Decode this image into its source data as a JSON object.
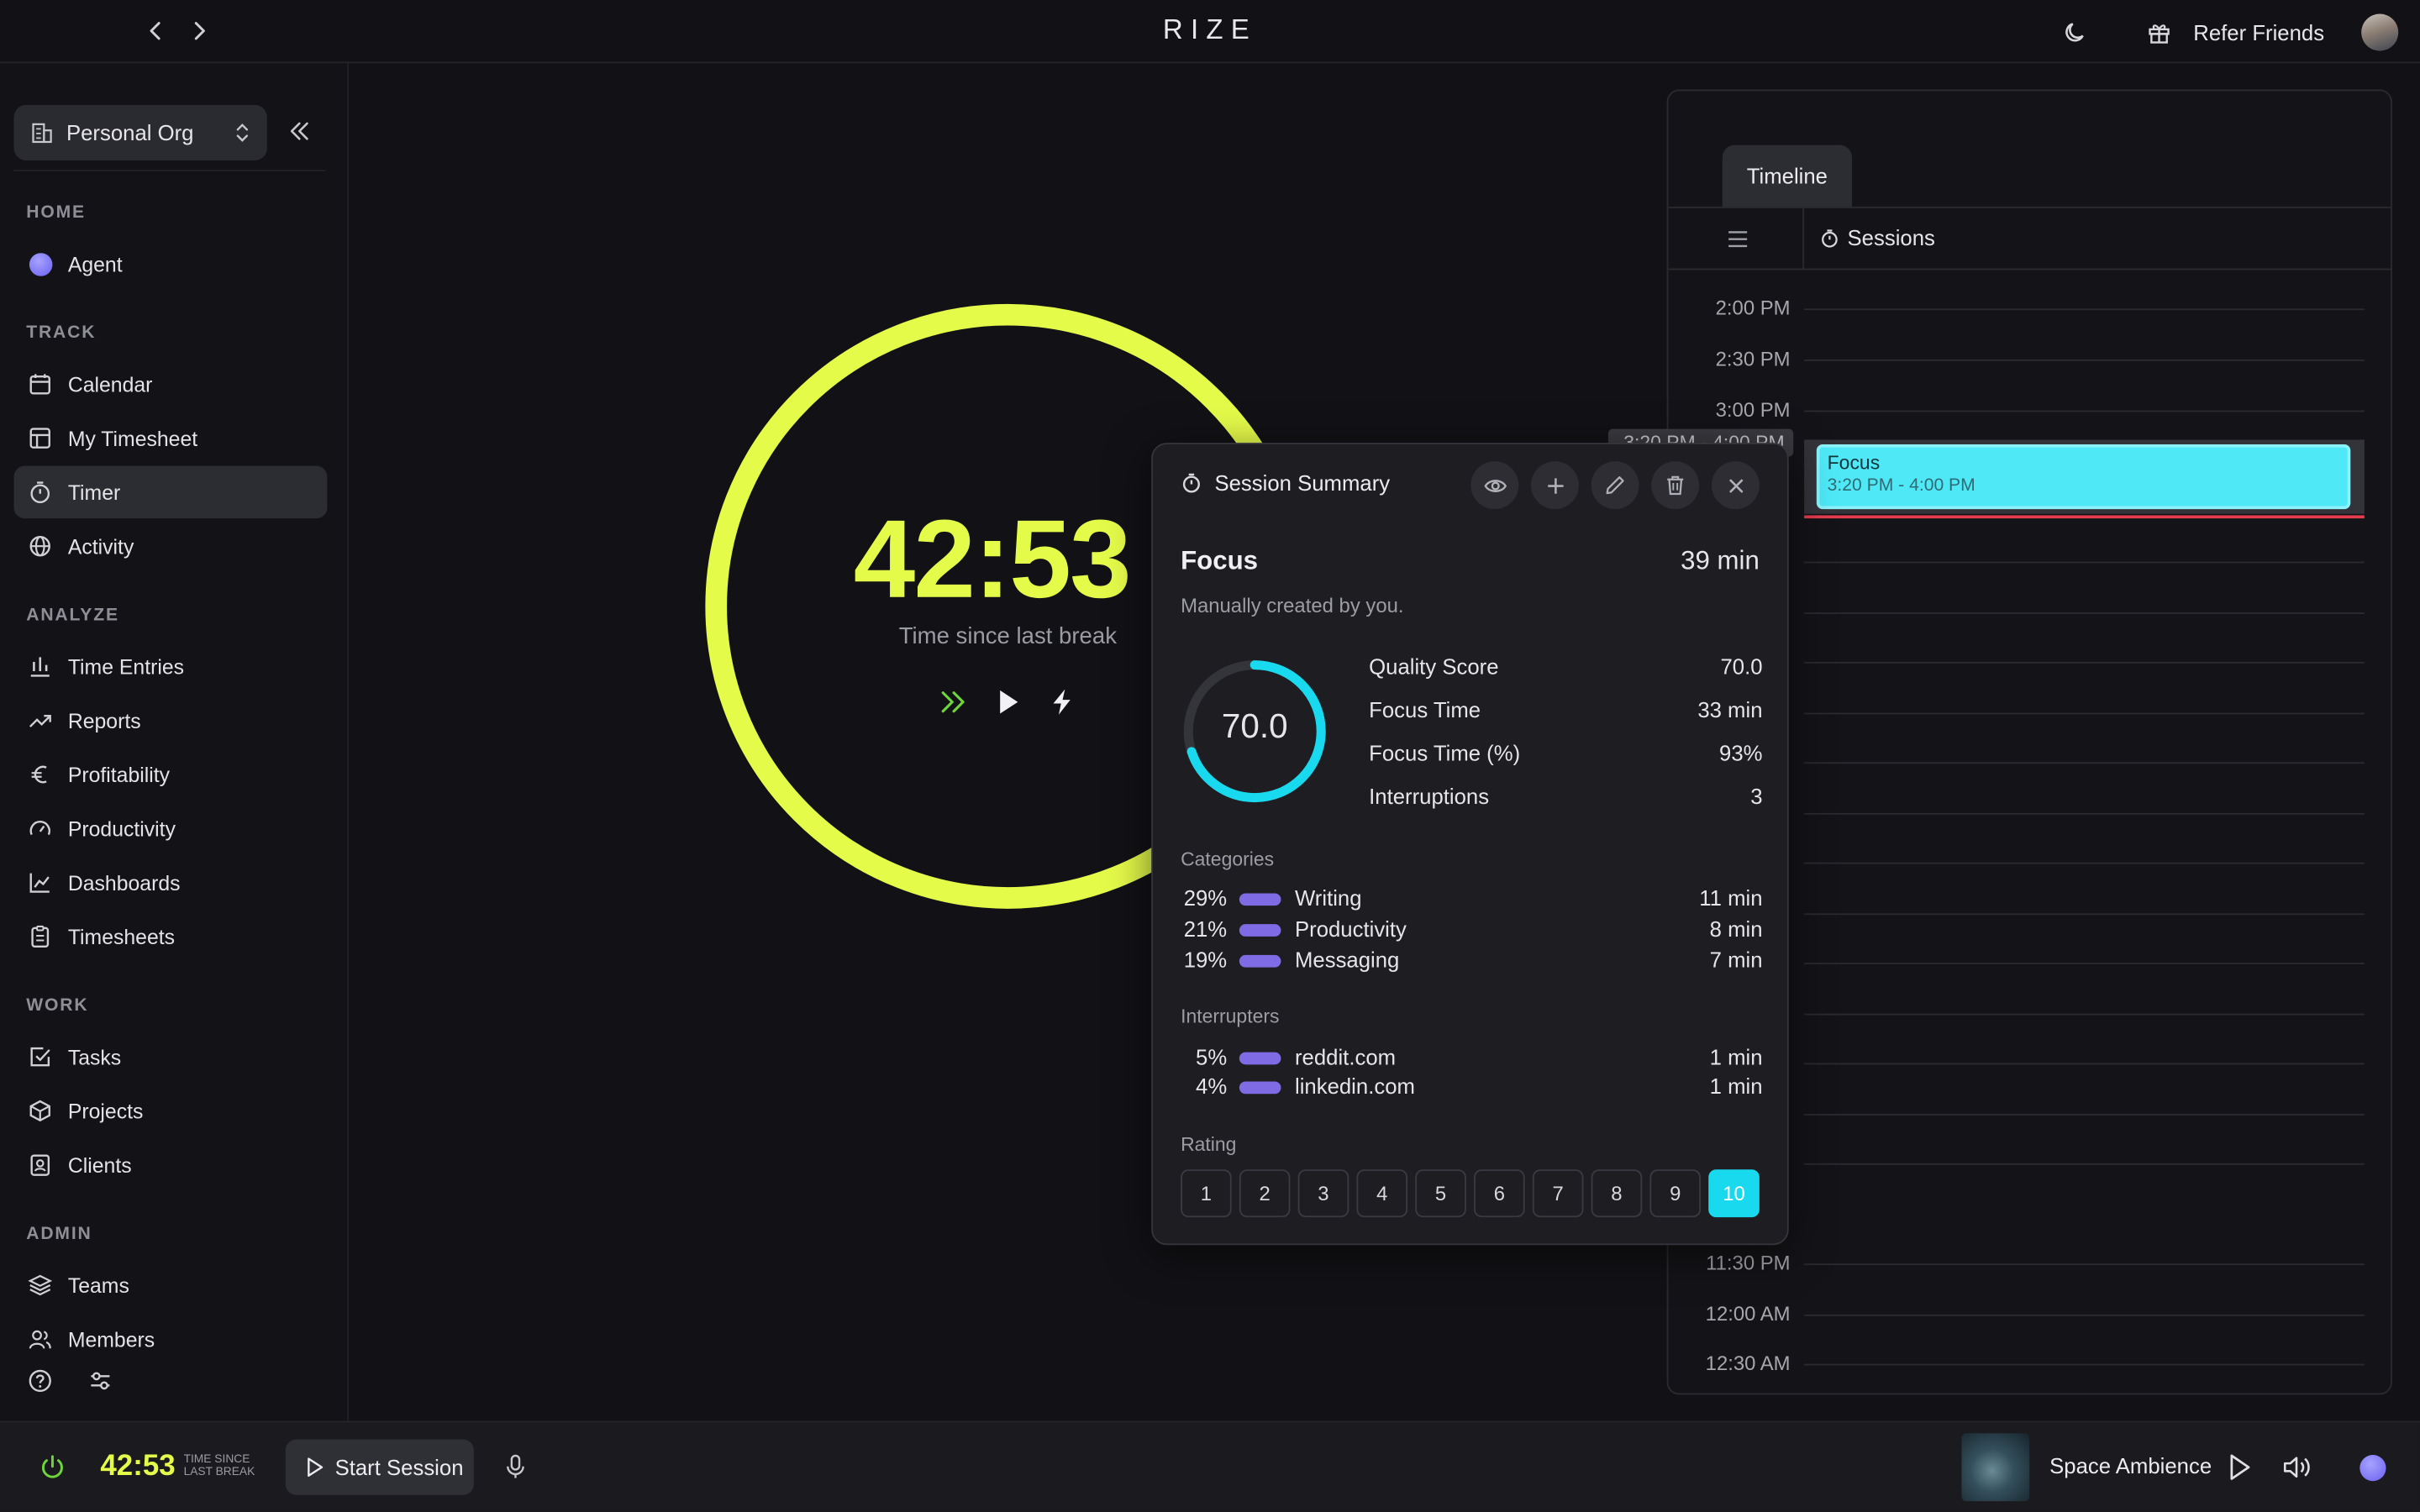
{
  "header": {
    "logo": "RIZE",
    "refer_label": "Refer Friends"
  },
  "sidebar": {
    "org": "Personal Org",
    "sections": {
      "home": "HOME",
      "track": "TRACK",
      "analyze": "ANALYZE",
      "work": "WORK",
      "admin": "ADMIN"
    },
    "items": {
      "agent": "Agent",
      "calendar": "Calendar",
      "timesheet": "My Timesheet",
      "timer": "Timer",
      "activity": "Activity",
      "time_entries": "Time Entries",
      "reports": "Reports",
      "profitability": "Profitability",
      "productivity": "Productivity",
      "dashboards": "Dashboards",
      "timesheets": "Timesheets",
      "tasks": "Tasks",
      "projects": "Projects",
      "clients": "Clients",
      "teams": "Teams",
      "members": "Members"
    },
    "active": "Timer"
  },
  "timer": {
    "value": "42:53",
    "label": "Time since last break",
    "ring_color": "#e5fb4a"
  },
  "timeline": {
    "tab": "Timeline",
    "sessions_label": "Sessions",
    "ghost_time": "3:20 PM - 4:00 PM",
    "top_times": [
      "2:00 PM",
      "2:30 PM",
      "3:00 PM"
    ],
    "bottom_times": [
      "11:30 PM",
      "12:00 AM",
      "12:30 AM"
    ],
    "block": {
      "title": "Focus",
      "range": "3:20 PM - 4:00 PM",
      "color": "#4fe8f7"
    }
  },
  "popup": {
    "title": "Session Summary",
    "session_name": "Focus",
    "duration": "39 min",
    "note": "Manually created by you.",
    "quality": {
      "value": "70.0",
      "fraction": 0.7
    },
    "stats": [
      {
        "label": "Quality Score",
        "value": "70.0"
      },
      {
        "label": "Focus Time",
        "value": "33 min"
      },
      {
        "label": "Focus Time (%)",
        "value": "93%"
      },
      {
        "label": "Interruptions",
        "value": "3"
      }
    ],
    "categories_label": "Categories",
    "categories": [
      {
        "pct": "29%",
        "name": "Writing",
        "time": "11 min"
      },
      {
        "pct": "21%",
        "name": "Productivity",
        "time": "8 min"
      },
      {
        "pct": "19%",
        "name": "Messaging",
        "time": "7 min"
      }
    ],
    "interrupters_label": "Interrupters",
    "interrupters": [
      {
        "pct": "5%",
        "name": "reddit.com",
        "time": "1 min"
      },
      {
        "pct": "4%",
        "name": "linkedin.com",
        "time": "1 min"
      }
    ],
    "rating_label": "Rating",
    "ratings": [
      "1",
      "2",
      "3",
      "4",
      "5",
      "6",
      "7",
      "8",
      "9",
      "10"
    ],
    "selected_rating": "10",
    "accent": "#19d9ee"
  },
  "bottombar": {
    "time": "42:53",
    "label_line1": "TIME SINCE",
    "label_line2": "LAST BREAK",
    "start_label": "Start Session",
    "ambience": "Space Ambience"
  }
}
